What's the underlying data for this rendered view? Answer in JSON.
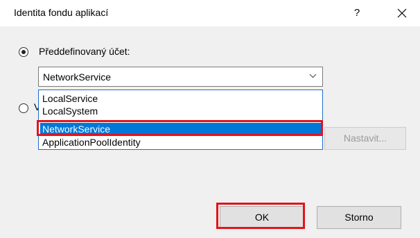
{
  "window": {
    "title": "Identita fondu aplikací",
    "help_label": "?",
    "close_icon": "close-icon"
  },
  "options": {
    "predefined_label": "Předdefinovaný účet:",
    "predefined_selected": true,
    "custom_label_visible": "V",
    "custom_selected": false
  },
  "combo": {
    "value": "NetworkService",
    "arrow_icon": "chevron-down-icon",
    "items": [
      "LocalService",
      "LocalSystem",
      "NetworkService",
      "ApplicationPoolIdentity"
    ],
    "selected_index": 2
  },
  "buttons": {
    "nastavit": "Nastavit...",
    "ok": "OK",
    "storno": "Storno"
  },
  "colors": {
    "selection": "#0078d7",
    "highlight": "#e3141b",
    "dialog_bg": "#f0f0f0"
  }
}
